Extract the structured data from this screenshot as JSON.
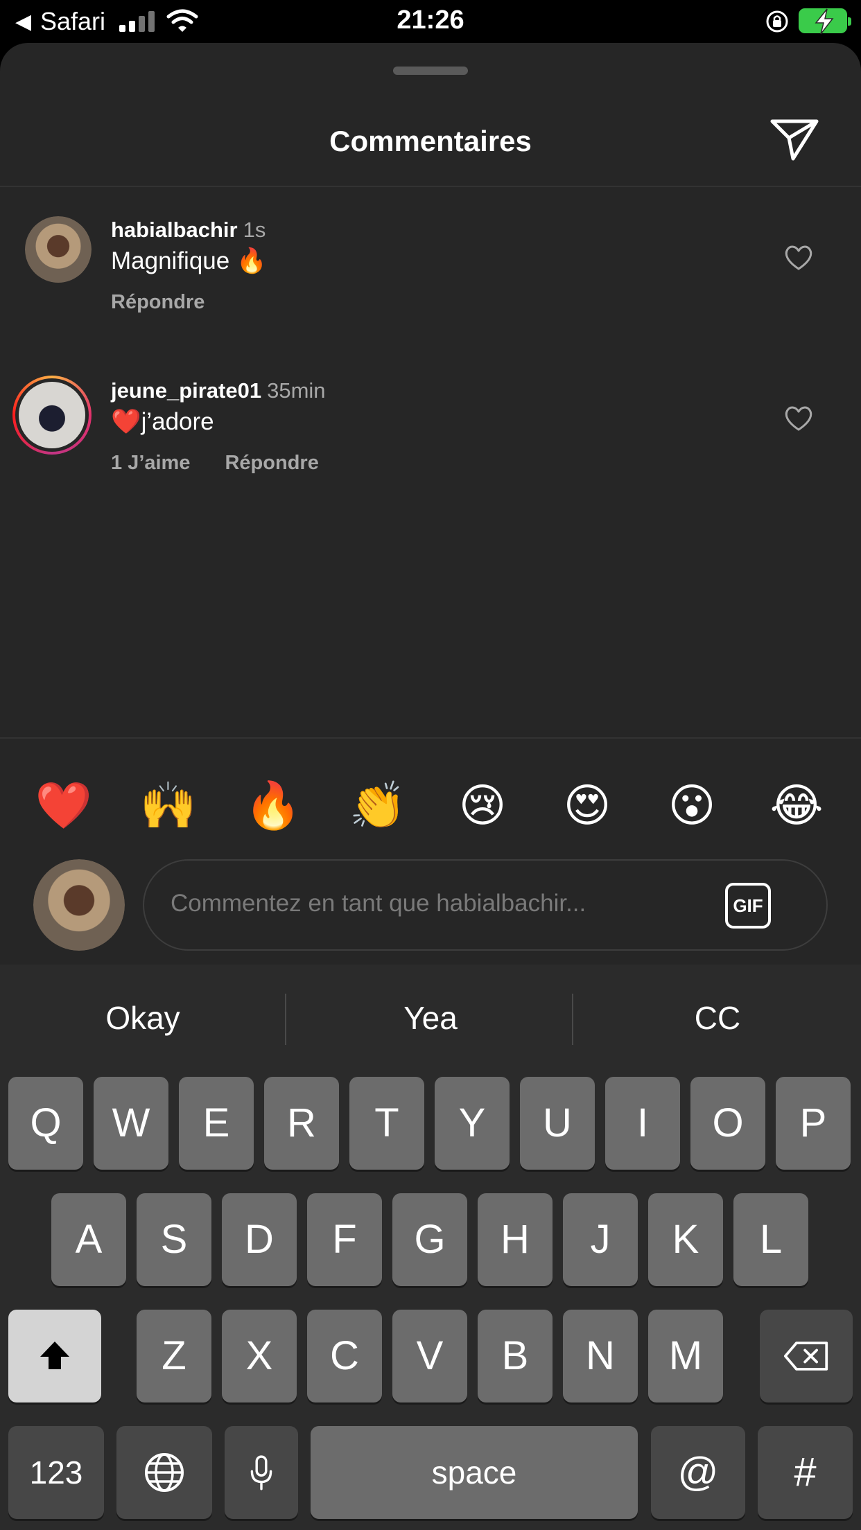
{
  "status_bar": {
    "back_app": "Safari",
    "time": "21:26",
    "battery_color": "#3acb4a"
  },
  "sheet": {
    "title": "Commentaires",
    "send_icon": "paper-plane-icon"
  },
  "comments": [
    {
      "username": "habialbachir",
      "time": "1s",
      "text": "Magnifique 🔥",
      "likes": "",
      "reply": "Répondre"
    },
    {
      "username": "jeune_pirate01",
      "time": "35min",
      "text": "❤️j’adore",
      "likes": "1 J’aime",
      "reply": "Répondre"
    }
  ],
  "emoji_bar": [
    "❤️",
    "🙌",
    "🔥",
    "👏",
    "😢",
    "😍",
    "😮",
    "😂"
  ],
  "composer": {
    "placeholder": "Commentez en tant que habialbachir...",
    "gif_label": "GIF"
  },
  "keyboard": {
    "suggestions": [
      "Okay",
      "Yea",
      "CC"
    ],
    "row1": [
      "Q",
      "W",
      "E",
      "R",
      "T",
      "Y",
      "U",
      "I",
      "O",
      "P"
    ],
    "row2": [
      "A",
      "S",
      "D",
      "F",
      "G",
      "H",
      "J",
      "K",
      "L"
    ],
    "row3": [
      "Z",
      "X",
      "C",
      "V",
      "B",
      "N",
      "M"
    ],
    "numbers_label": "123",
    "space_label": "space",
    "at_label": "@",
    "hash_label": "#"
  }
}
